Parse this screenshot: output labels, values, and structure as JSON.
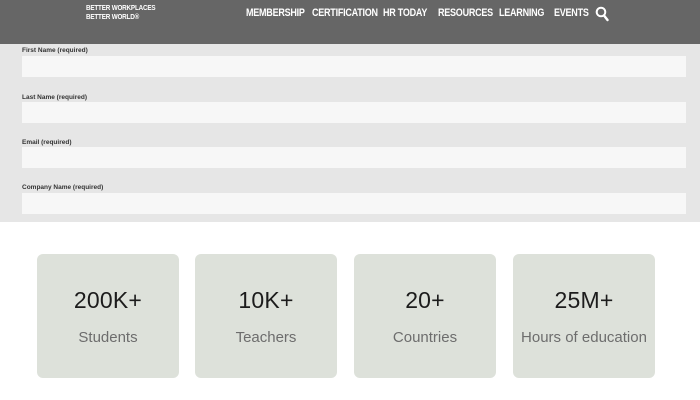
{
  "header": {
    "logo_lines": [
      "BETTER WORKPLACES",
      "BETTER WORLD®"
    ],
    "nav": [
      "MEMBERSHIP",
      "CERTIFICATION",
      "HR TODAY",
      "RESOURCES",
      "LEARNING",
      "EVENTS"
    ],
    "search_icon": "search-icon",
    "background_color": "#666666"
  },
  "form": {
    "fields": [
      {
        "label": "First Name (required)",
        "value": ""
      },
      {
        "label": "Last Name (required)",
        "value": ""
      },
      {
        "label": "Email (required)",
        "value": ""
      },
      {
        "label": "Company Name (required)",
        "value": ""
      }
    ],
    "background_color": "#e6e6e6"
  },
  "stats": [
    {
      "value": "200K+",
      "label": "Students"
    },
    {
      "value": "10K+",
      "label": "Teachers"
    },
    {
      "value": "20+",
      "label": "Countries"
    },
    {
      "value": "25M+",
      "label": "Hours of education"
    }
  ],
  "stat_card_color": "#dde1da"
}
